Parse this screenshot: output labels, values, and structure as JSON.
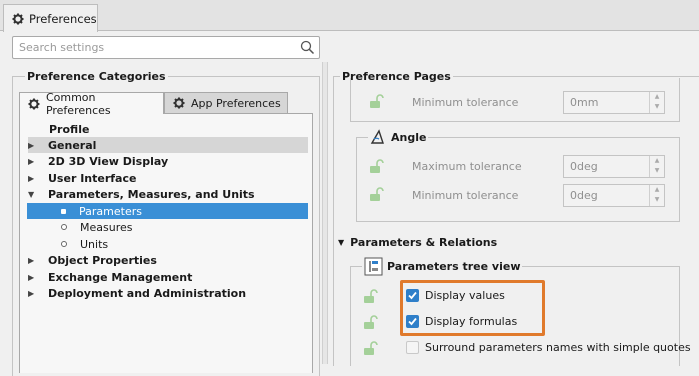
{
  "window_tab": {
    "label": "Preferences"
  },
  "search": {
    "placeholder": "Search settings"
  },
  "left_panel": {
    "title": "Preference Categories",
    "tabs": [
      {
        "label": "Common Preferences"
      },
      {
        "label": "App Preferences"
      }
    ],
    "tree": [
      {
        "label": "Profile"
      },
      {
        "label": "General"
      },
      {
        "label": "2D 3D View Display"
      },
      {
        "label": "User Interface"
      },
      {
        "label": "Parameters, Measures, and Units"
      },
      {
        "label": "Parameters"
      },
      {
        "label": "Measures"
      },
      {
        "label": "Units"
      },
      {
        "label": "Object Properties"
      },
      {
        "label": "Exchange Management"
      },
      {
        "label": "Deployment and Administration"
      }
    ]
  },
  "right_panel": {
    "title": "Preference Pages",
    "top_group": {
      "setting_label": "Minimum tolerance",
      "setting_value": "0mm"
    },
    "angle_group": {
      "title": "Angle",
      "settings": [
        {
          "label": "Maximum tolerance",
          "value": "0deg"
        },
        {
          "label": "Minimum tolerance",
          "value": "0deg"
        }
      ]
    },
    "section": {
      "title": "Parameters & Relations",
      "tree_view_title": "Parameters tree view",
      "checkboxes": [
        {
          "label": "Display values",
          "checked": true
        },
        {
          "label": "Display formulas",
          "checked": true
        },
        {
          "label": "Surround parameters names with simple quotes",
          "checked": false
        }
      ]
    }
  },
  "colors": {
    "selection": "#3a8fd6",
    "highlight_box": "#e07a2c",
    "lock_icon": "#5aa04a"
  }
}
